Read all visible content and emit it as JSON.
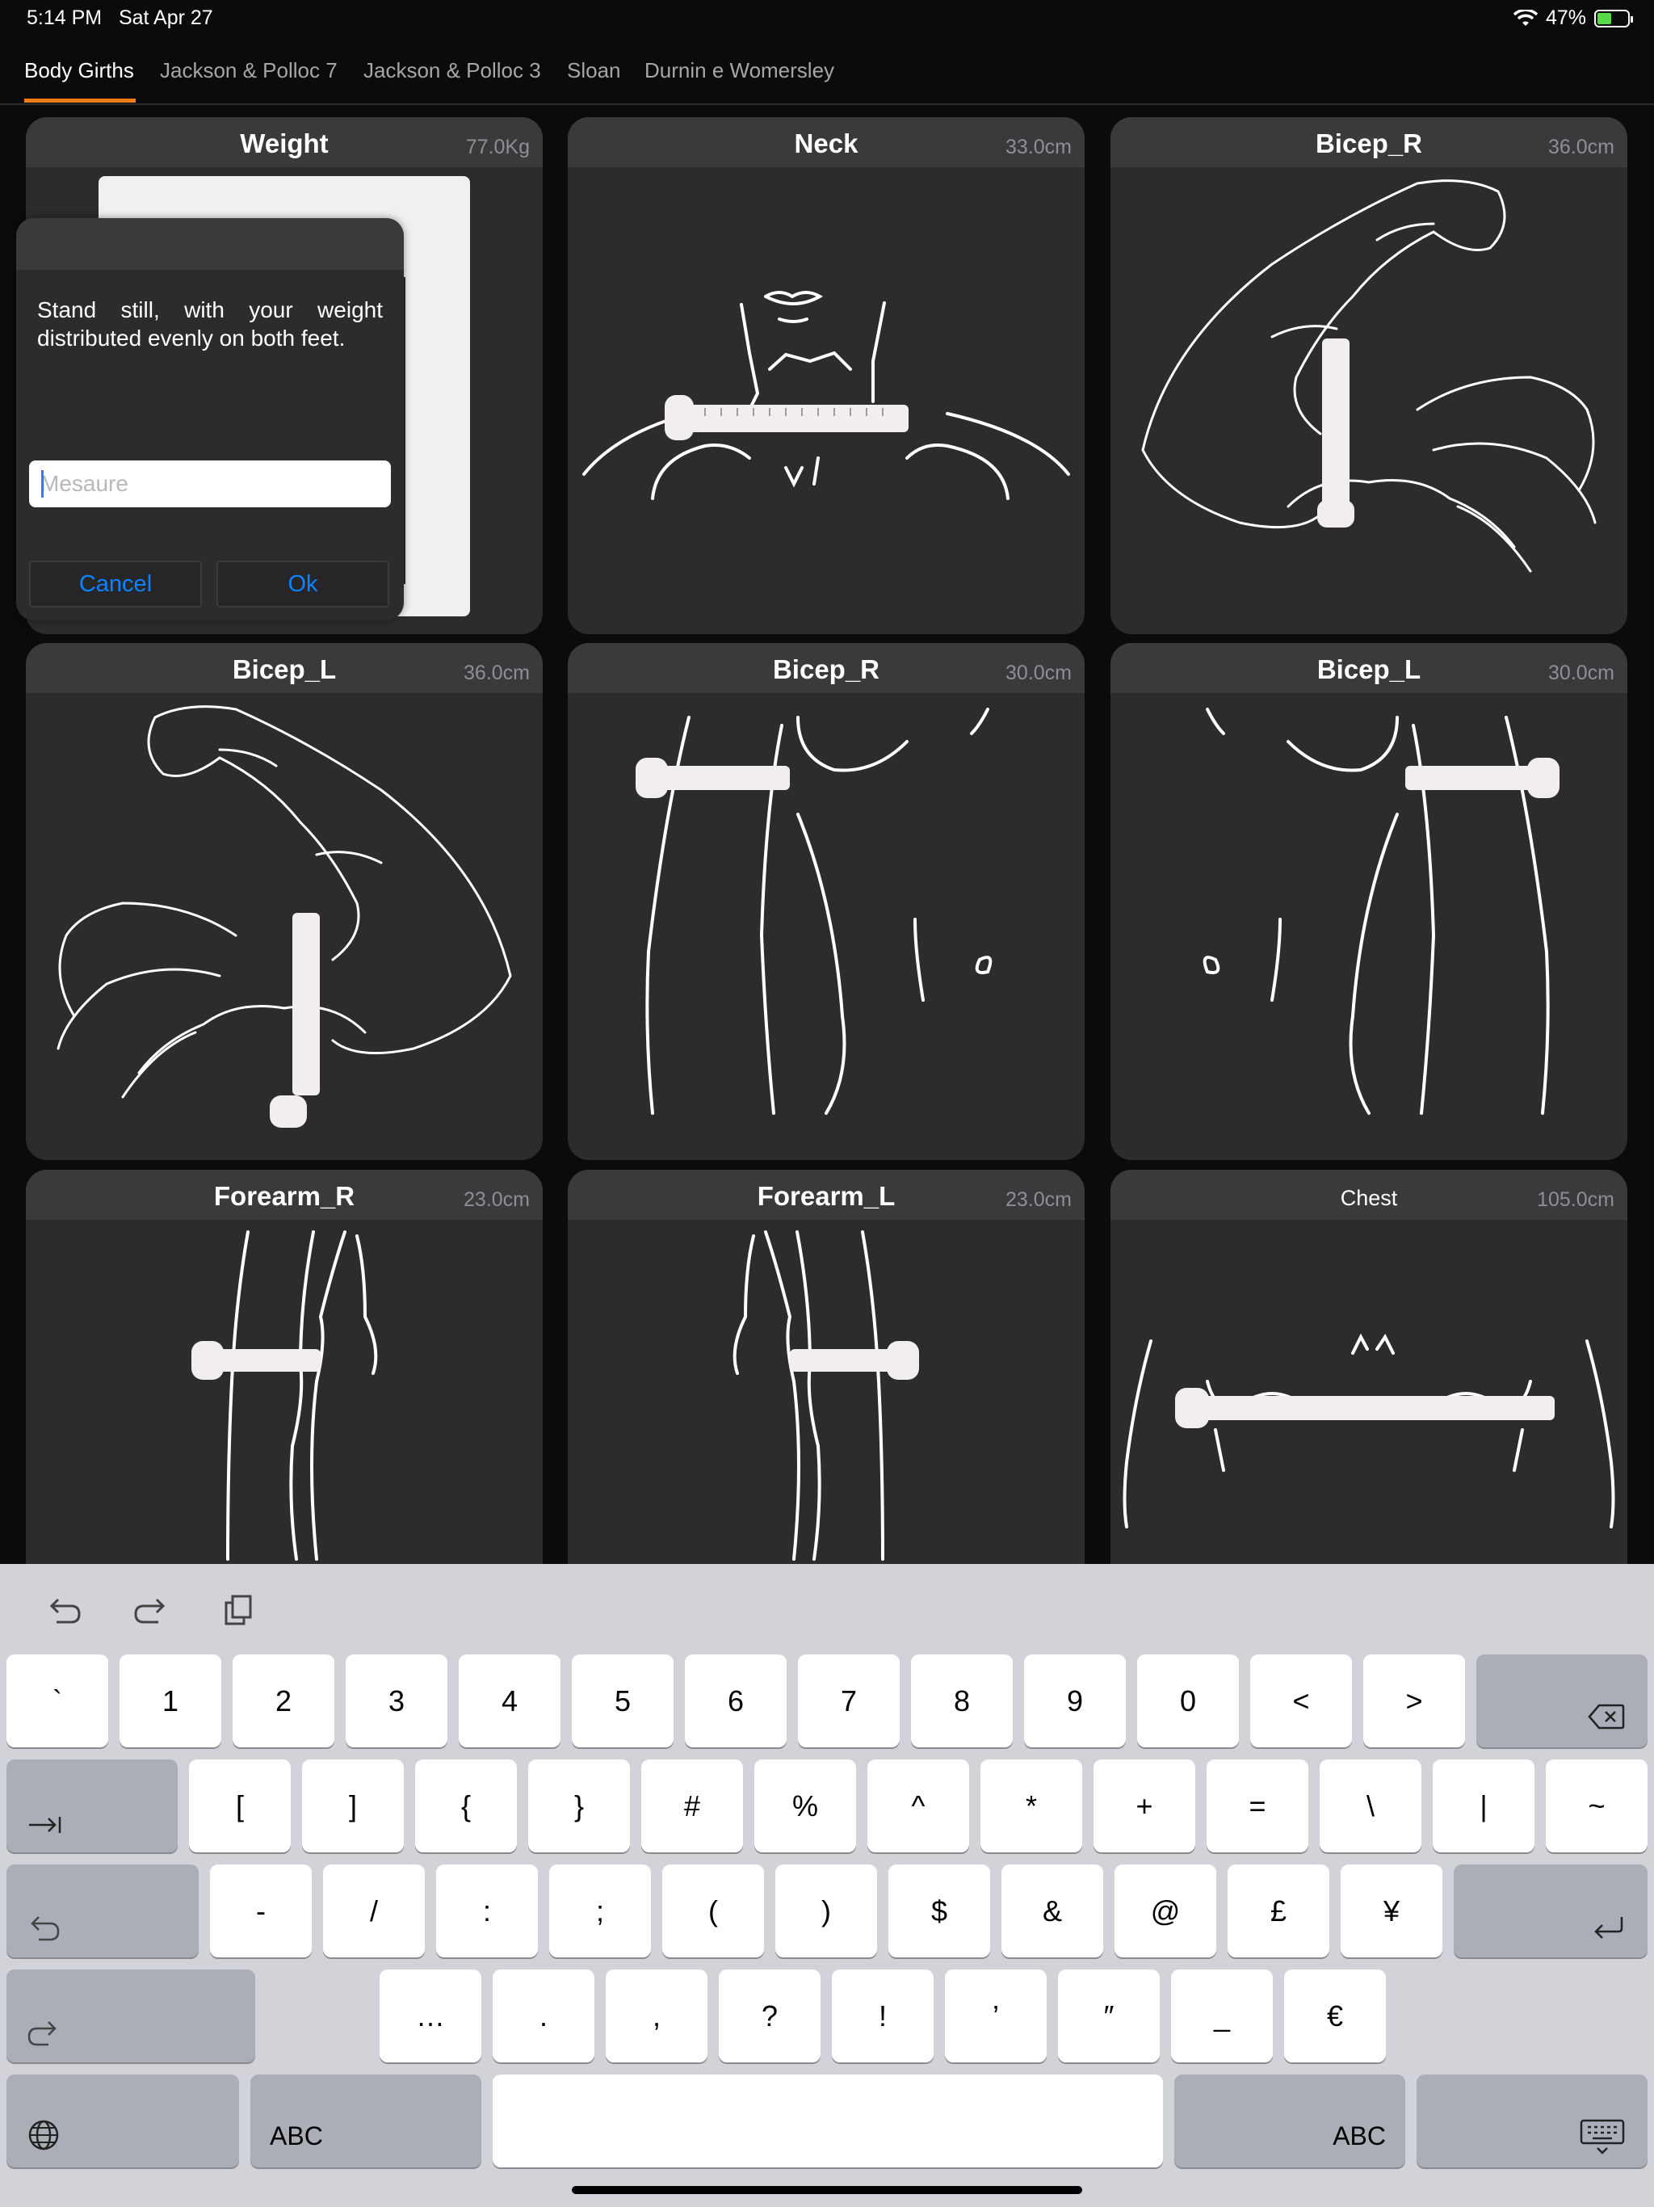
{
  "status_bar": {
    "time": "5:14 PM",
    "date": "Sat Apr 27",
    "battery": "47%",
    "battery_level": 0.47
  },
  "tabs": [
    {
      "label": "Body Girths",
      "active": true
    },
    {
      "label": "Jackson & Polloc 7",
      "active": false
    },
    {
      "label": "Jackson & Polloc 3",
      "active": false
    },
    {
      "label": "Sloan",
      "active": false
    },
    {
      "label": "Durnin e Womersley",
      "active": false
    }
  ],
  "cards": [
    {
      "title": "Weight",
      "value": "77.0Kg",
      "illustration": "scale"
    },
    {
      "title": "Neck",
      "value": "33.0cm",
      "illustration": "neck-tape"
    },
    {
      "title": "Bicep_R",
      "value": "36.0cm",
      "illustration": "flexed-arm-right"
    },
    {
      "title": "Bicep_L",
      "value": "36.0cm",
      "illustration": "flexed-arm-left"
    },
    {
      "title": "Bicep_R",
      "value": "30.0cm",
      "illustration": "relaxed-arm-right"
    },
    {
      "title": "Bicep_L",
      "value": "30.0cm",
      "illustration": "relaxed-arm-left"
    },
    {
      "title": "Forearm_R",
      "value": "23.0cm",
      "illustration": "forearm-right"
    },
    {
      "title": "Forearm_L",
      "value": "23.0cm",
      "illustration": "forearm-left"
    },
    {
      "title": "Chest",
      "value": "105.0cm",
      "illustration": "chest-tape"
    }
  ],
  "dialog": {
    "instruction": "Stand still, with your weight distributed evenly on both feet.",
    "input_value": "",
    "input_placeholder": "Mesaure",
    "cancel_label": "Cancel",
    "ok_label": "Ok"
  },
  "keyboard": {
    "toolbar": [
      "undo-icon",
      "redo-icon",
      "paste-icon"
    ],
    "row1": [
      "`",
      "1",
      "2",
      "3",
      "4",
      "5",
      "6",
      "7",
      "8",
      "9",
      "0",
      "<",
      ">"
    ],
    "row2": [
      "[",
      "]",
      "{",
      "}",
      "#",
      "%",
      "^",
      "*",
      "+",
      "=",
      "\\",
      "|",
      "~"
    ],
    "row3": [
      "-",
      "/",
      ":",
      ";",
      "(",
      ")",
      "$",
      "&",
      "@",
      "£",
      "¥"
    ],
    "row4": [
      "…",
      ".",
      ",",
      "?",
      "!",
      "’",
      "″",
      "_",
      "€"
    ],
    "abc_label": "ABC",
    "colors": {
      "background": "#d1d3d9",
      "key": "#ffffff",
      "special_key": "#abaeb7"
    }
  },
  "colors": {
    "accent": "#f57d14",
    "link": "#0a84ff",
    "card": "#2c2c2e",
    "card_header": "#3a3a3c"
  }
}
